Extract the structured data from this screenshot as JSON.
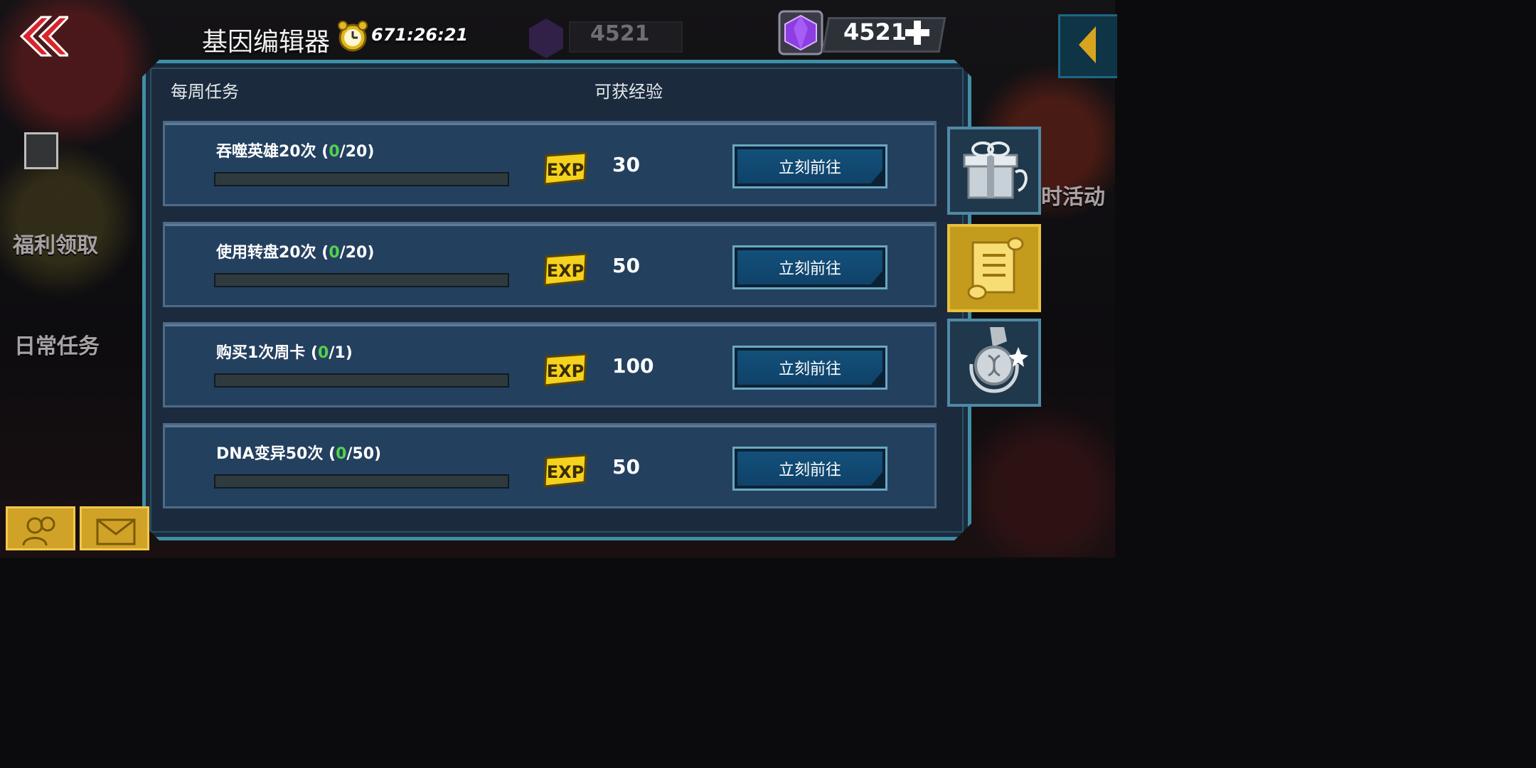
{
  "topbar": {
    "title": "基因编辑器",
    "timer": "671:26:21",
    "dim_currency_value": "4521",
    "gem_value": "4521"
  },
  "background": {
    "left_labels": [
      "福利领取",
      "日常任务"
    ],
    "right_label": "时活动"
  },
  "panel": {
    "header_tasks": "每周任务",
    "header_exp": "可获经验",
    "tasks": [
      {
        "name": "吞噬英雄20次",
        "current": "0",
        "total": "20",
        "progress": 0,
        "exp": "30",
        "button": "立刻前往"
      },
      {
        "name": "使用转盘20次",
        "current": "0",
        "total": "20",
        "progress": 0,
        "exp": "50",
        "button": "立刻前往"
      },
      {
        "name": "购买1次周卡",
        "current": "0",
        "total": "1",
        "progress": 0,
        "exp": "100",
        "button": "立刻前往"
      },
      {
        "name": "DNA变异50次",
        "current": "0",
        "total": "50",
        "progress": 0,
        "exp": "50",
        "button": "立刻前往"
      }
    ]
  },
  "side_tabs": [
    {
      "icon": "gift-box-icon",
      "active": false
    },
    {
      "icon": "scroll-icon",
      "active": true
    },
    {
      "icon": "dna-medal-icon",
      "active": false
    }
  ],
  "colors": {
    "panel_border": "#3f8fa6",
    "row_bg": "#24405f",
    "progress_green": "#52d24d",
    "exp_yellow": "#f4d21d",
    "button_blue": "#13507a",
    "active_tab_gold": "#c59b1e"
  }
}
